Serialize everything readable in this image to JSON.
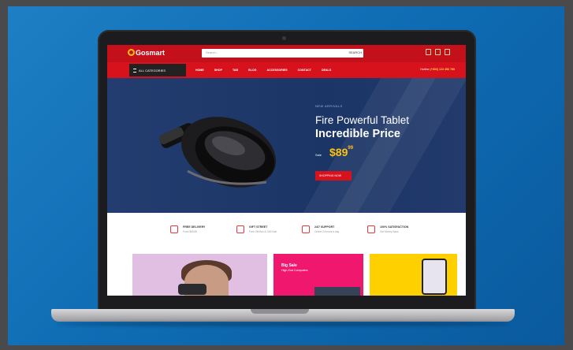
{
  "header": {
    "logo_text": "Gosmart",
    "search_placeholder": "Search...",
    "search_button": "SEARCH",
    "icons": [
      "user-icon",
      "heart-icon",
      "cart-icon"
    ]
  },
  "nav": {
    "categories_label": "ALL CATEGORIES",
    "links": [
      "HOME",
      "SHOP",
      "TAB",
      "BLOG",
      "ACCESSORIES",
      "CONTACT",
      "DEALS"
    ],
    "hotline_label": "Hotline",
    "hotline_number": "(+800) 123 456 789"
  },
  "hero": {
    "tag": "NEW ARRIVALS",
    "title": "Fire Powerful Tablet",
    "subtitle": "Incredible Price",
    "from_label": "Sale",
    "price": "$89",
    "price_cents": "99",
    "button": "SHOPPING NOW"
  },
  "services": [
    {
      "title": "FREE DELIVERY",
      "desc": "From $59.89"
    },
    {
      "title": "GIFT STREET",
      "desc": "Free Gift Box & Gift Note"
    },
    {
      "title": "24/7 SUPPORT",
      "desc": "Online 24 hours a day"
    },
    {
      "title": "100% SATISFACTION",
      "desc": "Get Money Back"
    }
  ],
  "banners": [
    {
      "title": "",
      "subtitle": ""
    },
    {
      "title": "Big Sale",
      "subtitle": "High-End Computers"
    },
    {
      "title": "",
      "subtitle": ""
    }
  ],
  "colors": {
    "brand_red": "#d8121d",
    "hero_navy": "#1b3566",
    "accent_yellow": "#ffc20e",
    "pink": "#f0176f",
    "background_blue": "#0f6db4"
  }
}
